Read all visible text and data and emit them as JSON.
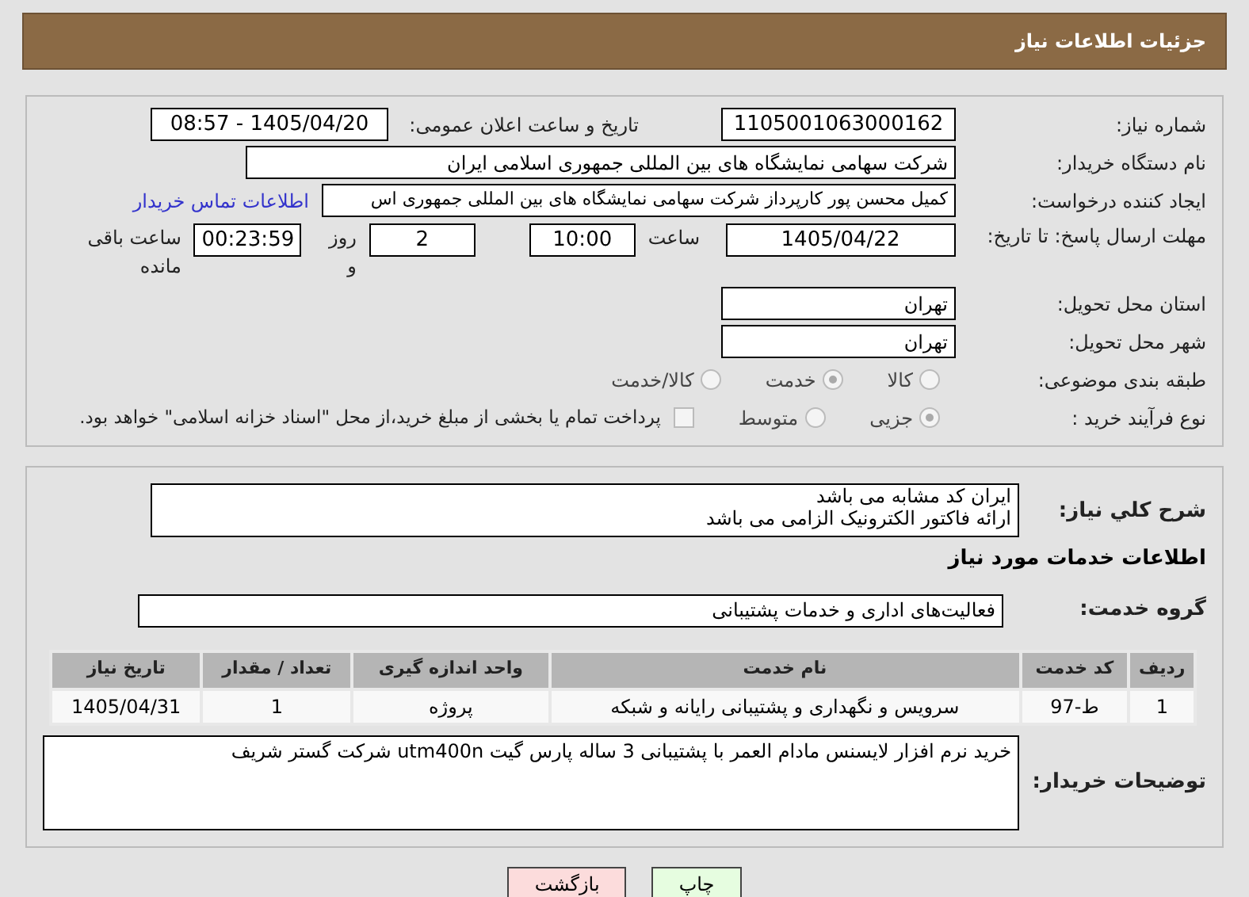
{
  "header": {
    "title": "جزئیات اطلاعات نیاز"
  },
  "info": {
    "need_number": {
      "label": "شماره نیاز:",
      "value": "1105001063000162"
    },
    "announce": {
      "label": "تاریخ و ساعت اعلان عمومی:",
      "value": "1405/04/20 - 08:57"
    },
    "buyer_org": {
      "label": "نام دستگاه خریدار:",
      "value": "شرکت سهامی نمایشگاه های بین المللی جمهوری اسلامی ایران"
    },
    "creator": {
      "label": "ایجاد کننده درخواست:",
      "value": "کمیل محسن پور کارپرداز شرکت سهامی نمایشگاه های بین المللی جمهوری اس",
      "link": "اطلاعات تماس خریدار"
    },
    "deadline": {
      "label": "مهلت ارسال پاسخ: تا تاریخ:",
      "date": "1405/04/22",
      "time_label": "ساعت",
      "time": "10:00",
      "days": "2",
      "days_label": "روز و",
      "remaining": "00:23:59",
      "remaining_label": "ساعت باقی مانده"
    },
    "province": {
      "label": "استان محل تحویل:",
      "value": "تهران"
    },
    "city": {
      "label": "شهر محل تحویل:",
      "value": "تهران"
    },
    "category": {
      "label": "طبقه بندی موضوعی:",
      "options": [
        {
          "label": "کالا",
          "selected": false
        },
        {
          "label": "خدمت",
          "selected": true
        },
        {
          "label": "کالا/خدمت",
          "selected": false
        }
      ]
    },
    "process": {
      "label": "نوع فرآیند خرید :",
      "options": [
        {
          "label": "جزیی",
          "selected": true
        },
        {
          "label": "متوسط",
          "selected": false
        }
      ],
      "payment": {
        "checked": false,
        "label": "پرداخت تمام یا بخشی از مبلغ خرید،از محل \"اسناد خزانه اسلامی\" خواهد بود."
      }
    }
  },
  "description": {
    "label": "شرح کلي نیاز:",
    "lines": [
      "ایران کد مشابه می باشد",
      "ارائه فاکتور الکترونیک الزامی می باشد"
    ]
  },
  "services_heading": "اطلاعات خدمات مورد نیاز",
  "service_group": {
    "label": "گروه خدمت:",
    "value": "فعالیت‌های اداری و خدمات پشتیبانی"
  },
  "table": {
    "columns": [
      "ردیف",
      "کد خدمت",
      "نام خدمت",
      "واحد اندازه گیری",
      "تعداد / مقدار",
      "تاریخ نیاز"
    ],
    "rows": [
      [
        "1",
        "ط-97",
        "سرویس و نگهداری و پشتیبانی رایانه و شبکه",
        "پروژه",
        "1",
        "1405/04/31"
      ]
    ]
  },
  "buyer_notes": {
    "label": "توضیحات خریدار:",
    "value": "خرید نرم افزار لایسنس مادام العمر با پشتیبانی 3 ساله  پارس گیت utm400n شرکت گستر شریف"
  },
  "buttons": [
    {
      "label": "چاپ",
      "kind": "print"
    },
    {
      "label": "بازگشت",
      "kind": "back"
    }
  ]
}
